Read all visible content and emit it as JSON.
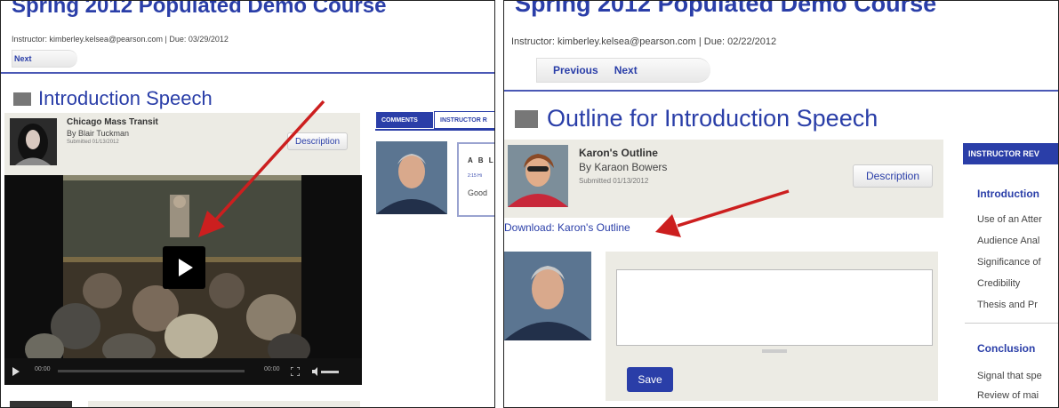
{
  "left": {
    "course_title": "Spring 2012 Populated Demo Course",
    "instructor": "Instructor: kimberley.kelsea@pearson.com | Due: 03/29/2012",
    "next_label": "Next",
    "page_title": "Introduction Speech",
    "submission": {
      "title": "Chicago Mass Transit",
      "by": "By Blair Tuckman",
      "submitted": "Submitted 01/13/2012",
      "description_label": "Description"
    },
    "tabs": {
      "comments": "COMMENTS",
      "instructor": "INSTRUCTOR R"
    },
    "comment": {
      "name": "A B L",
      "meta": "2:15 Hi",
      "text": "Good"
    },
    "player": {
      "time_current": "00:00",
      "time_total": "00:00"
    }
  },
  "right": {
    "course_title": "Spring 2012 Populated Demo Course",
    "instructor": "Instructor: kimberley.kelsea@pearson.com | Due: 02/22/2012",
    "previous_label": "Previous",
    "next_label": "Next",
    "page_title": "Outline for Introduction Speech",
    "submission": {
      "title": "Karon's Outline",
      "by": "By Karaon Bowers",
      "submitted": "Submitted 01/13/2012",
      "description_label": "Description"
    },
    "download_label": "Download: Karon's Outline",
    "comment_value": "",
    "save_label": "Save",
    "tab_label": "INSTRUCTOR REV",
    "rubric": {
      "intro_heading": "Introduction",
      "intro_items": [
        "Use of an Atter",
        "Audience Anal",
        "Significance of",
        "Credibility",
        "Thesis and Pr"
      ],
      "conclusion_heading": "Conclusion",
      "conclusion_items": [
        "Signal that spe",
        "Review of mai"
      ]
    }
  },
  "colors": {
    "link_blue": "#2a3ea8",
    "arrow_red": "#cc1f1f",
    "panel_bg": "#ecebe4"
  }
}
